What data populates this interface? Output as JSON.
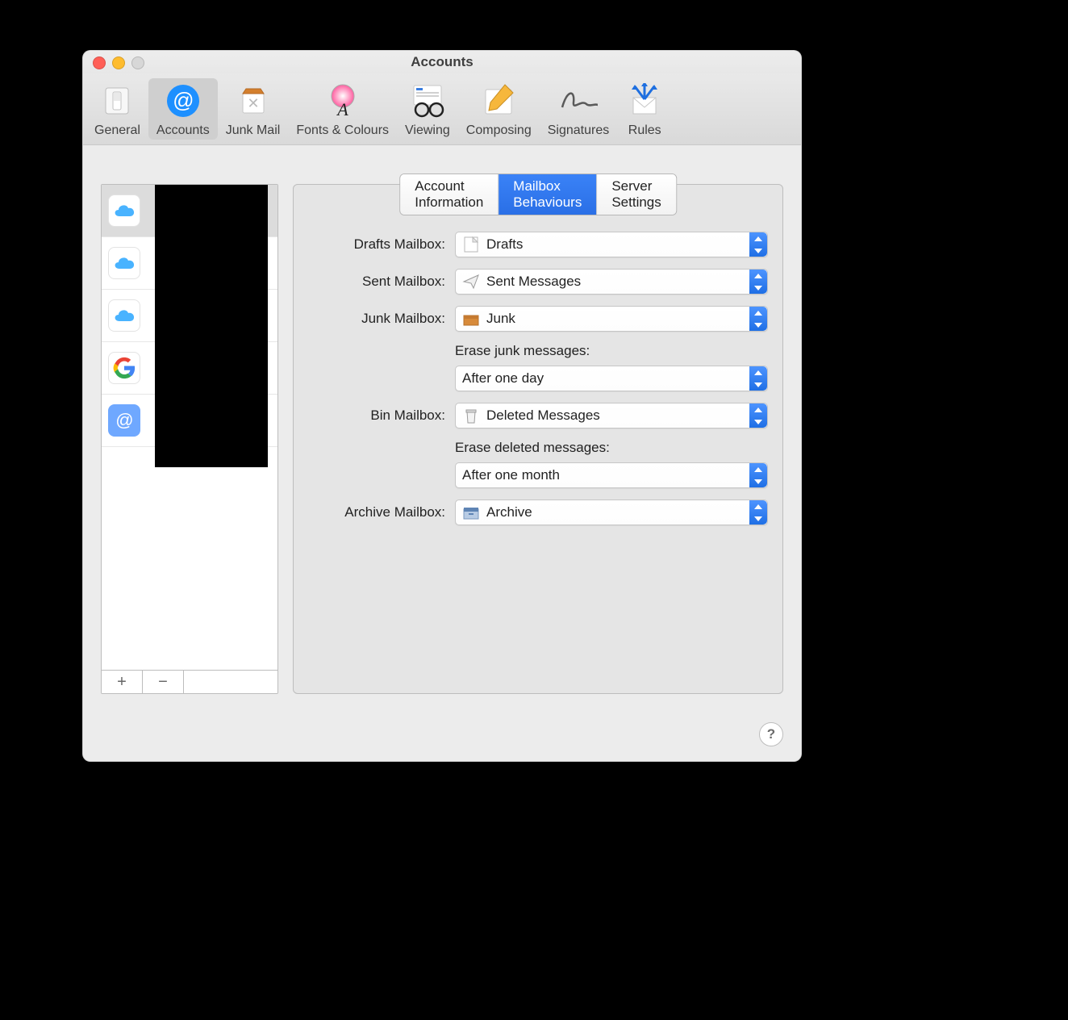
{
  "window": {
    "title": "Accounts"
  },
  "toolbar": {
    "items": [
      {
        "label": "General"
      },
      {
        "label": "Accounts"
      },
      {
        "label": "Junk Mail"
      },
      {
        "label": "Fonts & Colours"
      },
      {
        "label": "Viewing"
      },
      {
        "label": "Composing"
      },
      {
        "label": "Signatures"
      },
      {
        "label": "Rules"
      }
    ],
    "selected_index": 1
  },
  "sidebar": {
    "accounts": [
      {
        "provider": "icloud"
      },
      {
        "provider": "icloud"
      },
      {
        "provider": "icloud"
      },
      {
        "provider": "google"
      },
      {
        "provider": "generic"
      }
    ],
    "selected_index": 0,
    "add_label": "+",
    "remove_label": "−"
  },
  "tabs": {
    "items": [
      "Account Information",
      "Mailbox Behaviours",
      "Server Settings"
    ],
    "active_index": 1
  },
  "form": {
    "drafts": {
      "label": "Drafts Mailbox:",
      "value": "Drafts"
    },
    "sent": {
      "label": "Sent Mailbox:",
      "value": "Sent Messages"
    },
    "junk": {
      "label": "Junk Mailbox:",
      "value": "Junk"
    },
    "erase_junk_label": "Erase junk messages:",
    "erase_junk_value": "After one day",
    "bin": {
      "label": "Bin Mailbox:",
      "value": "Deleted Messages"
    },
    "erase_deleted_label": "Erase deleted messages:",
    "erase_deleted_value": "After one month",
    "archive": {
      "label": "Archive Mailbox:",
      "value": "Archive"
    }
  },
  "help_label": "?"
}
